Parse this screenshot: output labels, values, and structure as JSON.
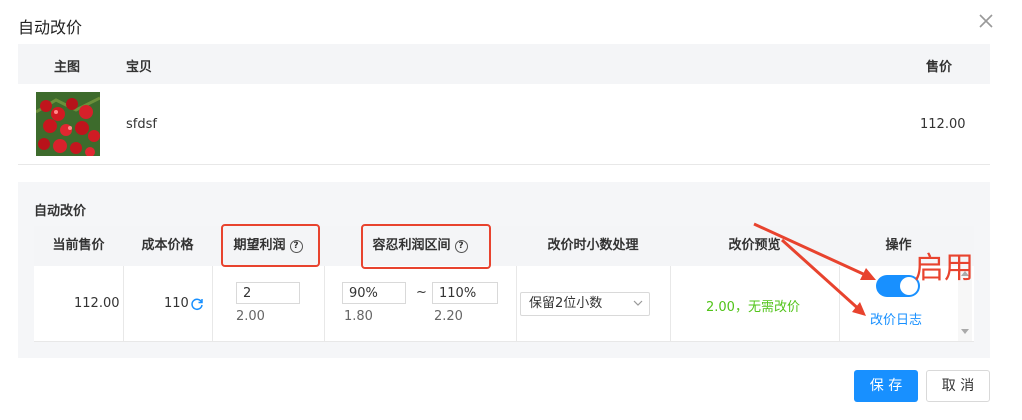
{
  "dialog": {
    "title": "自动改价",
    "close_icon": "close-icon"
  },
  "product_table": {
    "headers": {
      "image": "主图",
      "item": "宝贝",
      "price": "售价"
    },
    "row": {
      "name": "sfdsf",
      "price": "112.00"
    }
  },
  "auto_price": {
    "section_title": "自动改价",
    "headers": {
      "current_price": "当前售价",
      "cost_price": "成本价格",
      "expected_profit": "期望利润",
      "tolerance_range": "容忍利润区间",
      "decimal_handling": "改价时小数处理",
      "price_preview": "改价预览",
      "action": "操作"
    },
    "row": {
      "current_price": "112.00",
      "cost_price": "110",
      "expected_profit_value": "2",
      "expected_profit_calc": "2.00",
      "tolerance_min": "90%",
      "tolerance_separator": "~",
      "tolerance_max": "110%",
      "tolerance_min_calc": "1.80",
      "tolerance_max_calc": "2.20",
      "decimal_option": "保留2位小数",
      "preview_text": "2.00，无需改价",
      "toggle_on": true,
      "log_link": "改价日志"
    }
  },
  "annotation": {
    "label": "启用",
    "color": "#e8432e"
  },
  "footer": {
    "save_label": "保 存",
    "cancel_label": "取 消"
  },
  "colors": {
    "primary": "#1890ff",
    "success": "#52c41a",
    "annotation": "#e8432e"
  }
}
